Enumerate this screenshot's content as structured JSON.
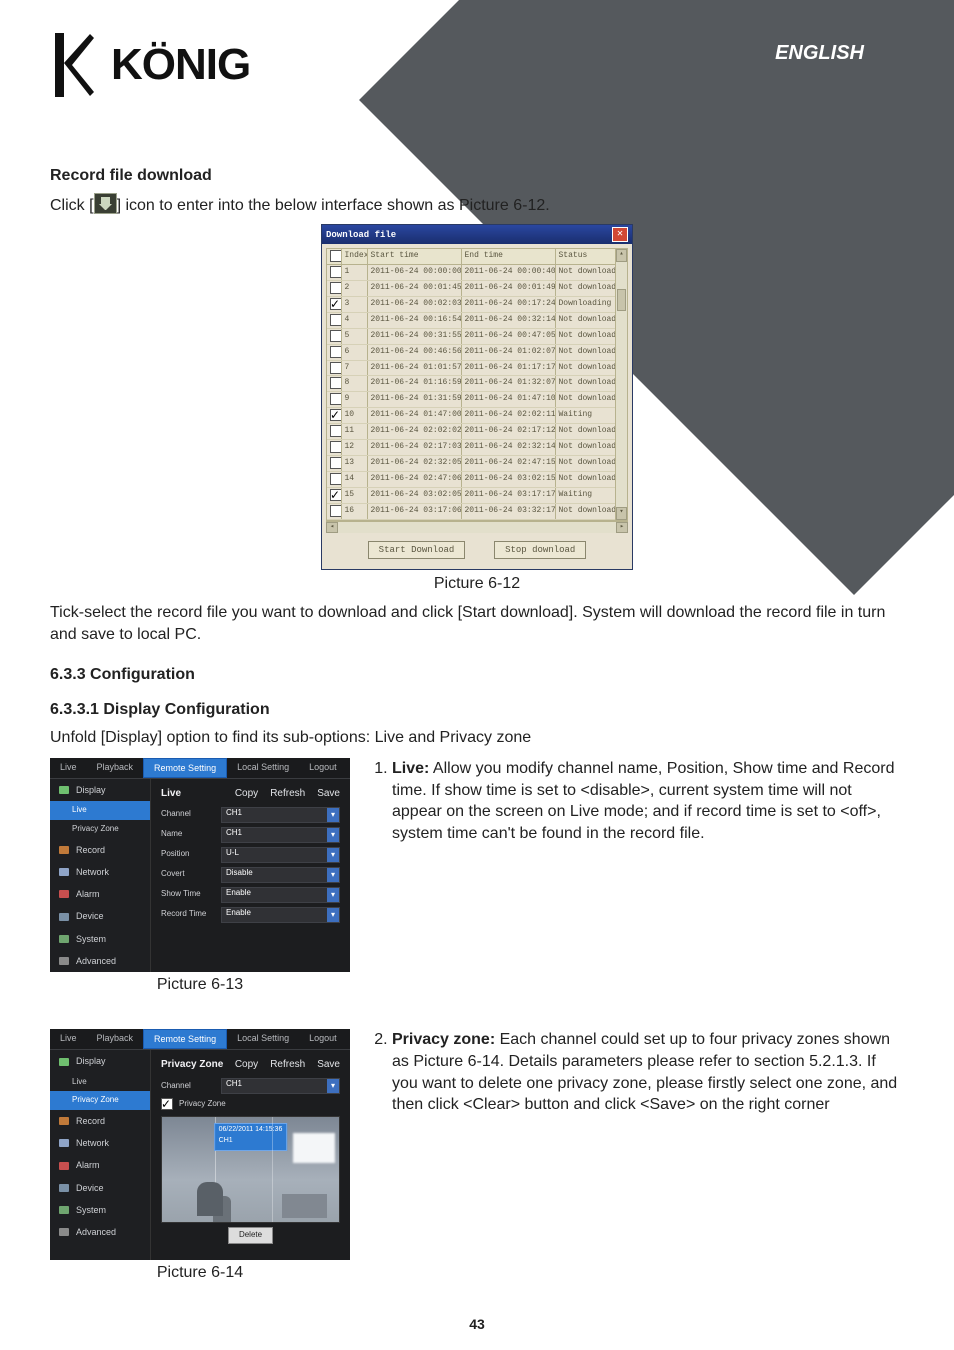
{
  "language_label": "ENGLISH",
  "brand": "KÖNIG",
  "section_title": "Record file download",
  "click_sentence_prefix": "Click [",
  "click_sentence_suffix": "] icon to enter into the below interface shown as Picture 6-12.",
  "dialog": {
    "title": "Download file",
    "columns": [
      "",
      "Index",
      "Start time",
      "End time",
      "Status"
    ],
    "rows": [
      {
        "c": false,
        "idx": "1",
        "st": "2011-06-24 00:00:00",
        "et": "2011-06-24 00:00:40",
        "s": "Not download"
      },
      {
        "c": false,
        "idx": "2",
        "st": "2011-06-24 00:01:45",
        "et": "2011-06-24 00:01:49",
        "s": "Not download"
      },
      {
        "c": true,
        "idx": "3",
        "st": "2011-06-24 00:02:03",
        "et": "2011-06-24 00:17:24",
        "s": "Downloading"
      },
      {
        "c": false,
        "idx": "4",
        "st": "2011-06-24 00:16:54",
        "et": "2011-06-24 00:32:14",
        "s": "Not download"
      },
      {
        "c": false,
        "idx": "5",
        "st": "2011-06-24 00:31:55",
        "et": "2011-06-24 00:47:05",
        "s": "Not download"
      },
      {
        "c": false,
        "idx": "6",
        "st": "2011-06-24 00:46:56",
        "et": "2011-06-24 01:02:07",
        "s": "Not download"
      },
      {
        "c": false,
        "idx": "7",
        "st": "2011-06-24 01:01:57",
        "et": "2011-06-24 01:17:17",
        "s": "Not download"
      },
      {
        "c": false,
        "idx": "8",
        "st": "2011-06-24 01:16:59",
        "et": "2011-06-24 01:32:07",
        "s": "Not download"
      },
      {
        "c": false,
        "idx": "9",
        "st": "2011-06-24 01:31:59",
        "et": "2011-06-24 01:47:10",
        "s": "Not download"
      },
      {
        "c": true,
        "idx": "10",
        "st": "2011-06-24 01:47:00",
        "et": "2011-06-24 02:02:11",
        "s": "Waiting"
      },
      {
        "c": false,
        "idx": "11",
        "st": "2011-06-24 02:02:02",
        "et": "2011-06-24 02:17:12",
        "s": "Not download"
      },
      {
        "c": false,
        "idx": "12",
        "st": "2011-06-24 02:17:03",
        "et": "2011-06-24 02:32:14",
        "s": "Not download"
      },
      {
        "c": false,
        "idx": "13",
        "st": "2011-06-24 02:32:05",
        "et": "2011-06-24 02:47:15",
        "s": "Not download"
      },
      {
        "c": false,
        "idx": "14",
        "st": "2011-06-24 02:47:06",
        "et": "2011-06-24 03:02:15",
        "s": "Not download"
      },
      {
        "c": true,
        "idx": "15",
        "st": "2011-06-24 03:02:05",
        "et": "2011-06-24 03:17:17",
        "s": "Waiting"
      },
      {
        "c": false,
        "idx": "16",
        "st": "2011-06-24 03:17:06",
        "et": "2011-06-24 03:32:17",
        "s": "Not download"
      }
    ],
    "btn_start": "Start Download",
    "btn_stop": "Stop download"
  },
  "caption_612": "Picture 6-12",
  "after_dialog_para": "Tick-select the record file you want to download and click [Start download]. System will download the record file in turn and save to local PC.",
  "h_633": "6.3.3 Configuration",
  "h_6331": "6.3.3.1 Display Configuration",
  "unfold_sentence": "Unfold [Display] option to find its sub-options: Live and Privacy zone",
  "tabs": [
    "Live",
    "Playback",
    "Remote Setting",
    "Local Setting",
    "Logout"
  ],
  "sidebar": {
    "items": [
      {
        "label": "Display",
        "subs": [
          "Live",
          "Privacy Zone"
        ]
      },
      {
        "label": "Record"
      },
      {
        "label": "Network"
      },
      {
        "label": "Alarm"
      },
      {
        "label": "Device"
      },
      {
        "label": "System"
      },
      {
        "label": "Advanced"
      }
    ]
  },
  "panel_live": {
    "title": "Live",
    "top_btns": [
      "Copy",
      "Refresh",
      "Save"
    ],
    "rows": [
      {
        "k": "Channel",
        "v": "CH1"
      },
      {
        "k": "Name",
        "v": "CH1"
      },
      {
        "k": "Position",
        "v": "U-L"
      },
      {
        "k": "Covert",
        "v": "Disable"
      },
      {
        "k": "Show Time",
        "v": "Enable"
      },
      {
        "k": "Record Time",
        "v": "Enable"
      }
    ]
  },
  "caption_613": "Picture 6-13",
  "list1_label": "Live:",
  "list1_text": " Allow you modify channel name, Position, Show time and Record time. If show time is set to <disable>, current system time will not appear on the screen on Live mode; and if record time is set to <off>, system time can't be found in the record file.",
  "panel_privacy": {
    "title": "Privacy Zone",
    "top_btns": [
      "Copy",
      "Refresh",
      "Save"
    ],
    "channel_k": "Channel",
    "channel_v": "CH1",
    "mask_chk_label": "Privacy Zone",
    "timestamp": "06/22/2011 14:15:36",
    "timestamp_ch": "CH1",
    "btn_delete": "Delete"
  },
  "caption_614": "Picture 6-14",
  "list2_label": "Privacy zone:",
  "list2_text": " Each channel could set up to four privacy zones shown as Picture 6-14. Details parameters please refer to section 5.2.1.3. If you want to delete one privacy zone, please firstly select one zone, and then click <Clear> button and click <Save> on the right corner",
  "page_number": "43"
}
